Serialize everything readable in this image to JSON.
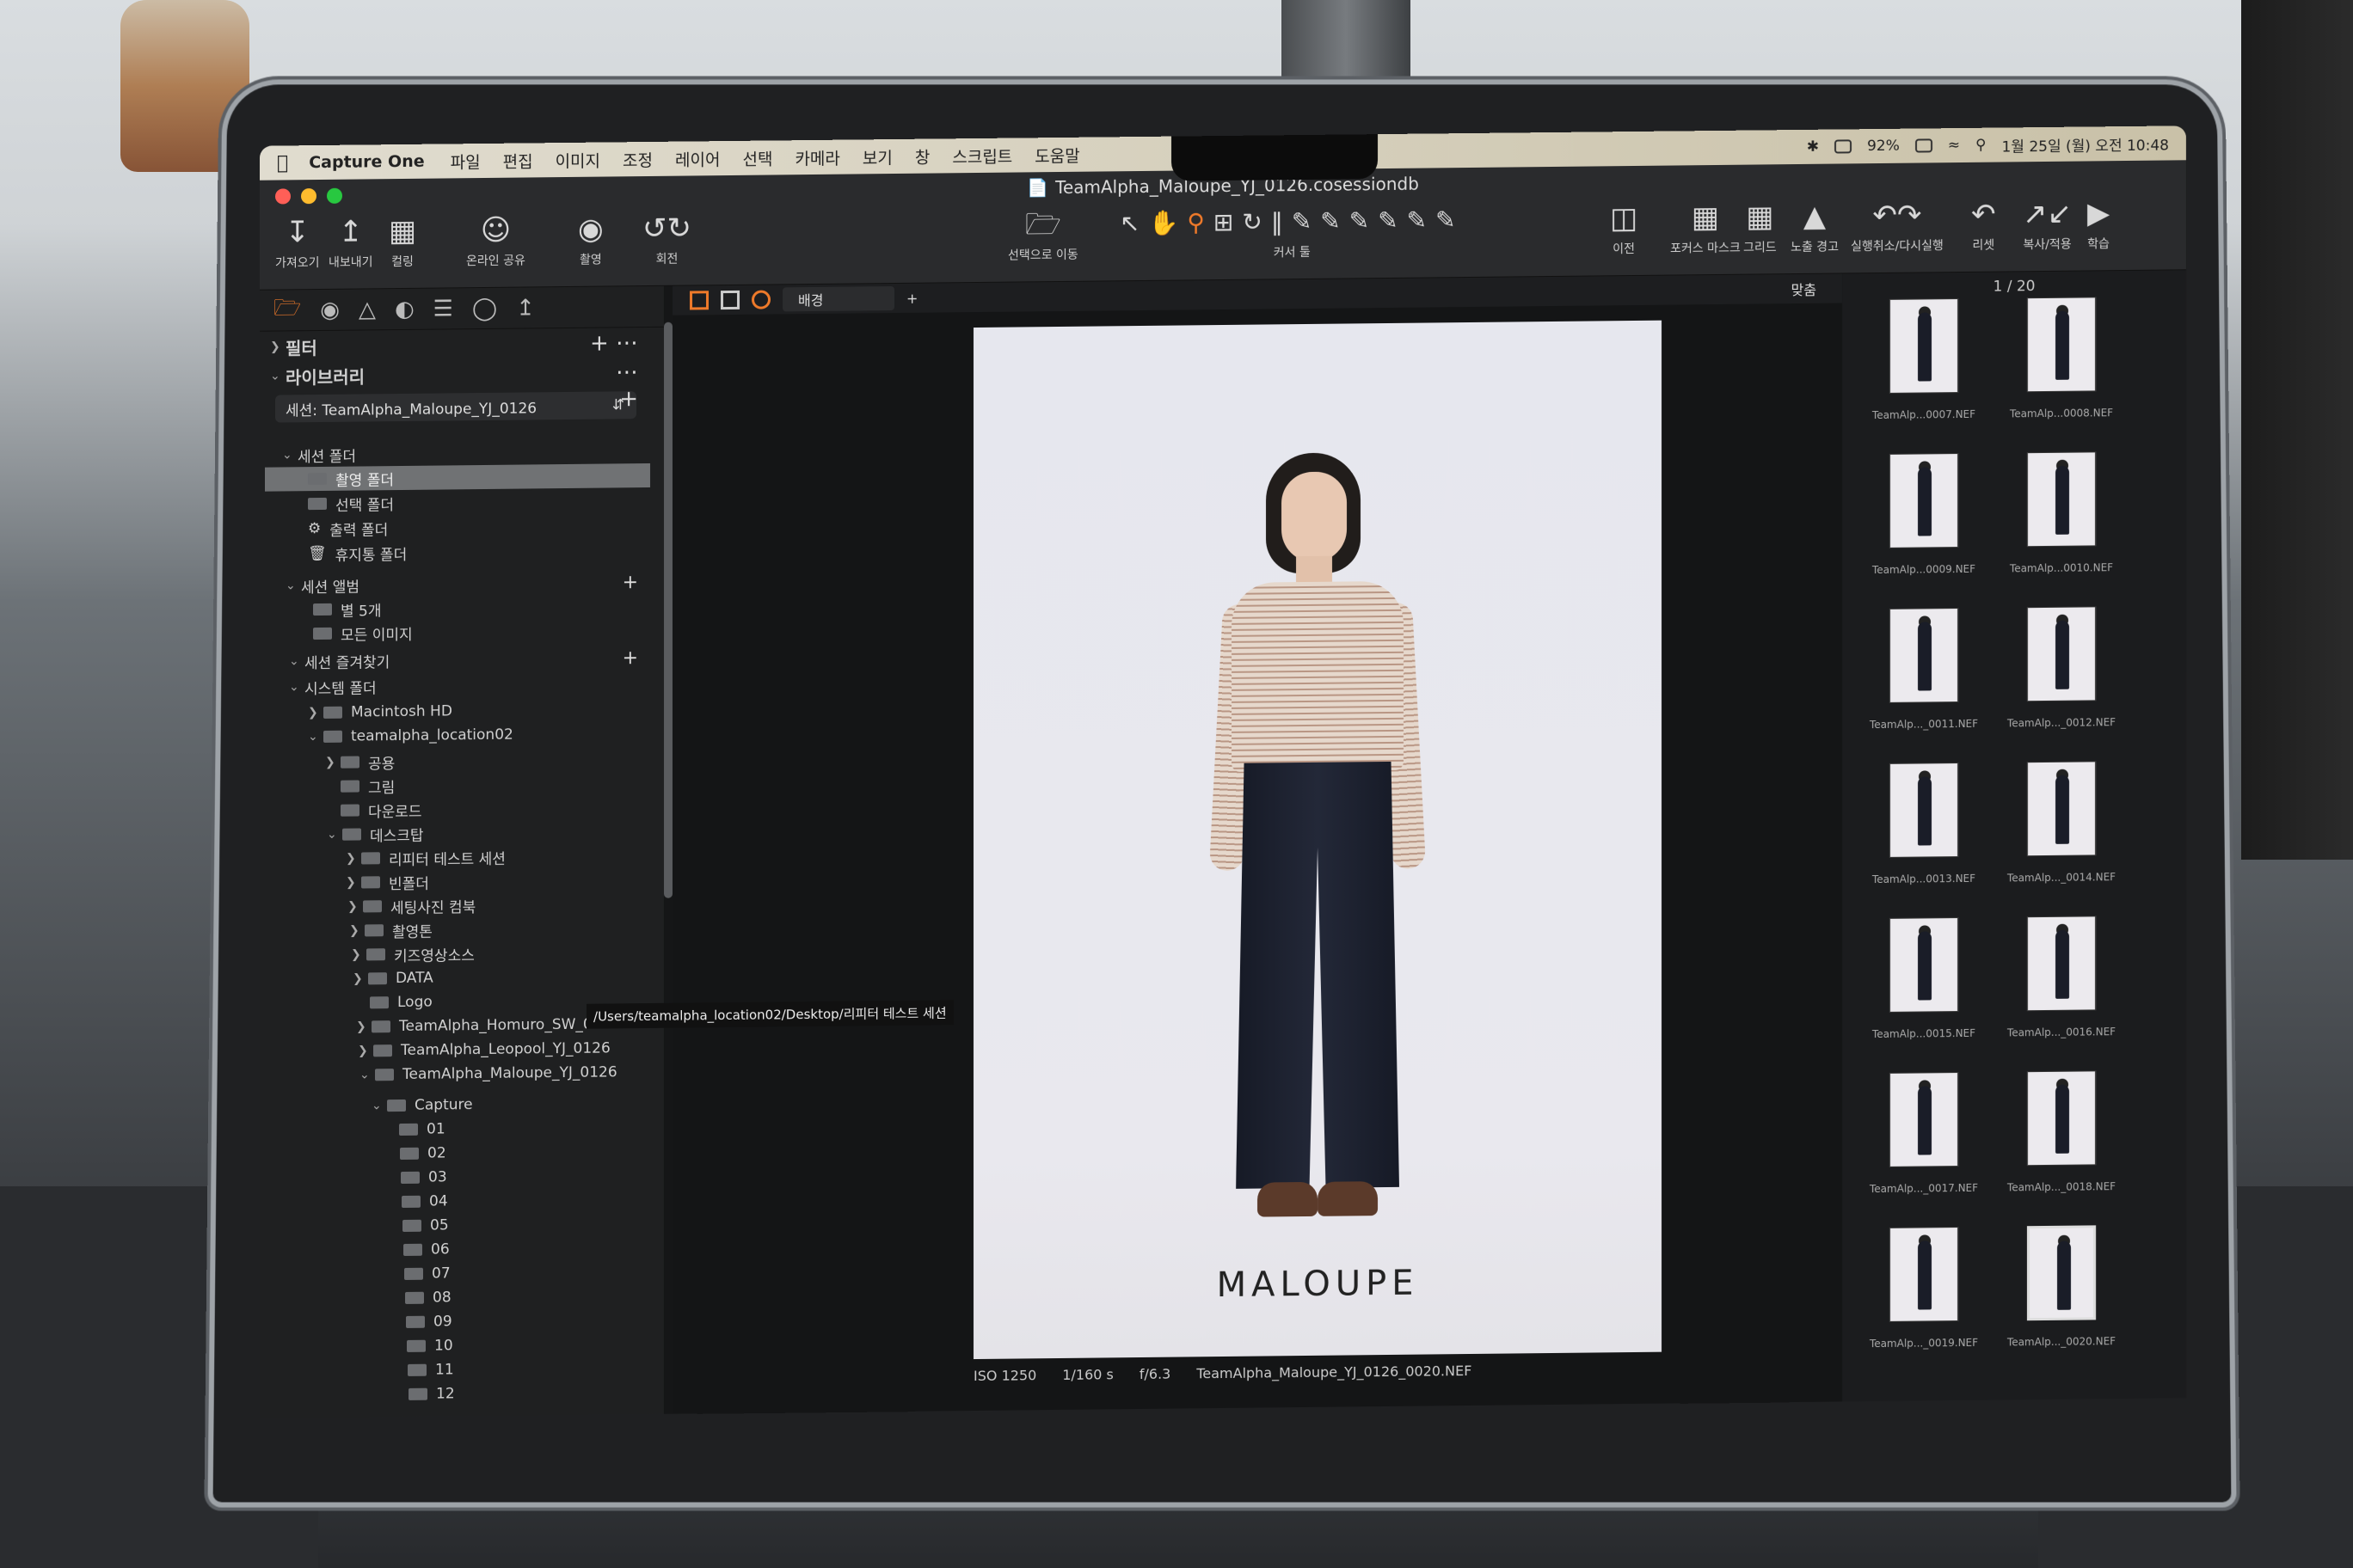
{
  "menubar": {
    "app_name": "Capture One",
    "items": [
      "파일",
      "편집",
      "이미지",
      "조정",
      "레이어",
      "선택",
      "카메라",
      "보기",
      "창",
      "스크립트",
      "도움말"
    ],
    "battery": "92%",
    "datetime": "1월 25일 (월) 오전 10:48"
  },
  "window": {
    "title": "TeamAlpha_Maloupe_YJ_0126.cosessiondb"
  },
  "toolbar": {
    "import": "가져오기",
    "export": "내보내기",
    "rating": "컬링",
    "share": "온라인 공유",
    "capture": "촬영",
    "rotate": "회전",
    "move_to_select": "선택으로 이동",
    "cursor_tools": "커서 툴",
    "before": "이전",
    "focus_mask": "포커스 마스크",
    "grid": "그리드",
    "exposure_warning": "노출 경고",
    "undo_redo": "실행취소/다시실행",
    "reset": "리셋",
    "copy_apply": "복사/적용",
    "learn": "학습"
  },
  "left_panel": {
    "filter_label": "필터",
    "library_label": "라이브러리",
    "session_select": "세션: TeamAlpha_Maloupe_YJ_0126",
    "session_folders_label": "세션 폴더",
    "session_folders": [
      "촬영 폴더",
      "선택 폴더",
      "출력 폴더",
      "휴지통 폴더"
    ],
    "session_albums_label": "세션 앨범",
    "session_albums": [
      "별 5개",
      "모든 이미지"
    ],
    "favorites_label": "세션 즐겨찾기",
    "system_folders_label": "시스템 폴더",
    "tree": {
      "macintosh": "Macintosh HD",
      "user": "teamalpha_location02",
      "public": "공용",
      "pictures": "그림",
      "downloads": "다운로드",
      "desktop": "데스크탑",
      "desktop_children": [
        "리피터 테스트 세션",
        "빈폴더",
        "세팅사진 컴북",
        "촬영톤",
        "키즈영상소스",
        "DATA",
        "Logo",
        "TeamAlpha_Homuro_SW_0126",
        "TeamAlpha_Leopool_YJ_0126",
        "TeamAlpha_Maloupe_YJ_0126"
      ],
      "capture": "Capture",
      "capture_children": [
        "01",
        "02",
        "03",
        "04",
        "05",
        "06",
        "07",
        "08",
        "09",
        "10",
        "11",
        "12"
      ]
    },
    "tooltip": "/Users/teamalpha_location02/Desktop/리피터 테스트 세션"
  },
  "viewer": {
    "background_select": "배경",
    "brand": "MALOUPE",
    "iso": "ISO 1250",
    "shutter": "1/160 s",
    "aperture": "f/6.3",
    "filename": "TeamAlpha_Maloupe_YJ_0126_0020.NEF",
    "fit_label": "맞춤"
  },
  "filmstrip": {
    "counter": "1 / 20",
    "thumbs": [
      {
        "name": "TeamAlp...0007.NEF"
      },
      {
        "name": "TeamAlp...0008.NEF"
      },
      {
        "name": "TeamAlp...0009.NEF"
      },
      {
        "name": "TeamAlp...0010.NEF"
      },
      {
        "name": "TeamAlp..._0011.NEF"
      },
      {
        "name": "TeamAlp..._0012.NEF"
      },
      {
        "name": "TeamAlp...0013.NEF"
      },
      {
        "name": "TeamAlp..._0014.NEF"
      },
      {
        "name": "TeamAlp...0015.NEF"
      },
      {
        "name": "TeamAlp..._0016.NEF"
      },
      {
        "name": "TeamAlp..._0017.NEF"
      },
      {
        "name": "TeamAlp..._0018.NEF"
      },
      {
        "name": "TeamAlp..._0019.NEF"
      },
      {
        "name": "TeamAlp..._0020.NEF"
      }
    ]
  },
  "colors": {
    "accent": "#ef7a2a",
    "panel": "#1f2021"
  }
}
